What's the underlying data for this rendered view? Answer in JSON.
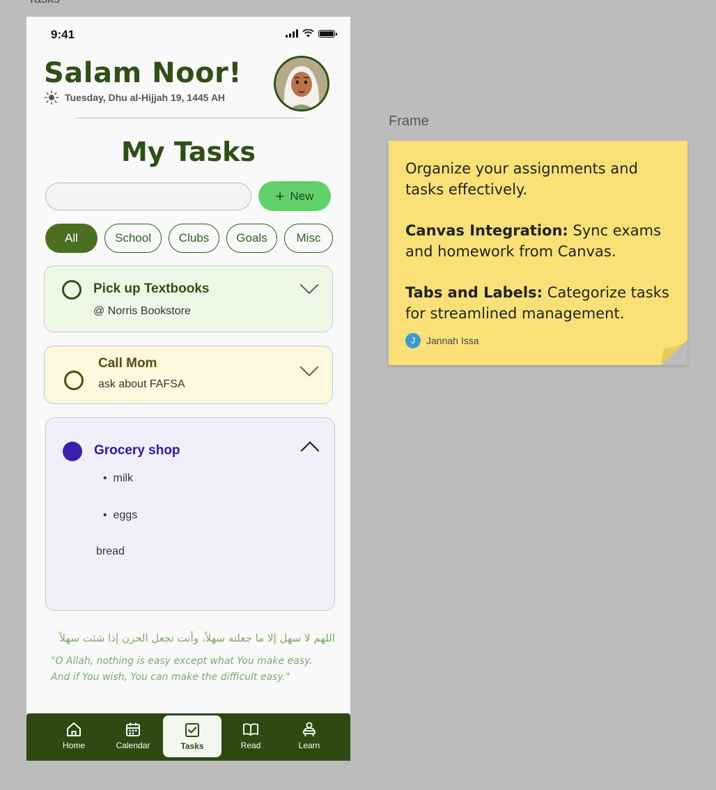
{
  "canvas": {
    "frame_label": "Tasks"
  },
  "status": {
    "time": "9:41"
  },
  "header": {
    "greeting": "Salam Noor!",
    "date": "Tuesday, Dhu al-Hijjah 19, 1445 AH"
  },
  "page_title": "My Tasks",
  "search": {
    "value": "",
    "placeholder": ""
  },
  "new_button": {
    "label": "New"
  },
  "filters": [
    {
      "label": "All",
      "active": true
    },
    {
      "label": "School",
      "active": false
    },
    {
      "label": "Clubs",
      "active": false
    },
    {
      "label": "Goals",
      "active": false
    },
    {
      "label": "Misc",
      "active": false
    }
  ],
  "tasks": [
    {
      "title": "Pick up Textbooks",
      "subtitle": "@ Norris Bookstore",
      "color": "#2e4f16",
      "expanded": false,
      "completed": false
    },
    {
      "title": "Call Mom",
      "subtitle": "ask about FAFSA",
      "color": "#5a4a10",
      "expanded": false,
      "completed": false
    },
    {
      "title": "Grocery shop",
      "items": [
        "milk",
        "eggs"
      ],
      "note": "bread",
      "color": "#2e1a99",
      "expanded": true,
      "completed": true
    }
  ],
  "quote": {
    "arabic": "اللهم لا سهل إلا ما جعلته سهلاً، وأنت تجعل الحزن إذا شئت سهلاً",
    "translation": "\"O Allah, nothing is easy except what You make easy. And if You wish, You can make the difficult easy.\""
  },
  "nav": [
    {
      "label": "Home",
      "icon": "home-icon",
      "active": false
    },
    {
      "label": "Calendar",
      "icon": "calendar-icon",
      "active": false
    },
    {
      "label": "Tasks",
      "icon": "checkbox-icon",
      "active": true
    },
    {
      "label": "Read",
      "icon": "book-icon",
      "active": false
    },
    {
      "label": "Learn",
      "icon": "learner-icon",
      "active": false
    }
  ],
  "sticky_note": {
    "frame_label": "Frame",
    "intro": "Organize your assignments and tasks effectively.",
    "feature1_title": "Canvas Integration:",
    "feature1_text": "Sync exams and homework from Canvas.",
    "feature2_title": "Tabs and Labels:",
    "feature2_text": "Categorize tasks for streamlined management.",
    "author_initial": "J",
    "author": "Jannah Issa"
  },
  "colors": {
    "brand_green": "#2e4f16",
    "new_button": "#62d16b",
    "card_green": "#eef8e6",
    "card_yellow": "#fdf8de",
    "card_purple": "#f2effb",
    "sticky": "#fae177"
  }
}
